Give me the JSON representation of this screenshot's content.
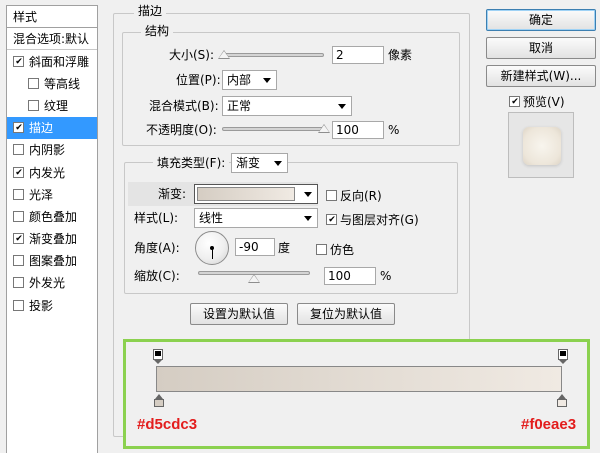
{
  "sidebar": {
    "header": "样式",
    "blend_options": "混合选项:默认",
    "items": [
      {
        "label": "斜面和浮雕",
        "checked": true,
        "sub": false,
        "active": false
      },
      {
        "label": "等高线",
        "checked": false,
        "sub": true,
        "active": false
      },
      {
        "label": "纹理",
        "checked": false,
        "sub": true,
        "active": false
      },
      {
        "label": "描边",
        "checked": true,
        "sub": false,
        "active": true
      },
      {
        "label": "内阴影",
        "checked": false,
        "sub": false,
        "active": false
      },
      {
        "label": "内发光",
        "checked": true,
        "sub": false,
        "active": false
      },
      {
        "label": "光泽",
        "checked": false,
        "sub": false,
        "active": false
      },
      {
        "label": "颜色叠加",
        "checked": false,
        "sub": false,
        "active": false
      },
      {
        "label": "渐变叠加",
        "checked": true,
        "sub": false,
        "active": false
      },
      {
        "label": "图案叠加",
        "checked": false,
        "sub": false,
        "active": false
      },
      {
        "label": "外发光",
        "checked": false,
        "sub": false,
        "active": false
      },
      {
        "label": "投影",
        "checked": false,
        "sub": false,
        "active": false
      }
    ]
  },
  "stroke": {
    "title": "描边",
    "structure": {
      "title": "结构",
      "size_label": "大小(S):",
      "size_value": "2",
      "size_unit": "像素",
      "size_fraction": 0.02,
      "position_label": "位置(P):",
      "position_value": "内部",
      "blend_label": "混合模式(B):",
      "blend_value": "正常",
      "opacity_label": "不透明度(O):",
      "opacity_value": "100",
      "opacity_unit": "%",
      "opacity_fraction": 1.0
    },
    "fill": {
      "type_label": "填充类型(F):",
      "type_value": "渐变",
      "gradient_label": "渐变:",
      "reverse_label": "反向(R)",
      "reverse_checked": false,
      "style_label": "样式(L):",
      "style_value": "线性",
      "align_label": "与图层对齐(G)",
      "align_checked": true,
      "angle_label": "角度(A):",
      "angle_value": "-90",
      "angle_unit": "度",
      "dither_label": "仿色",
      "dither_checked": false,
      "scale_label": "缩放(C):",
      "scale_value": "100",
      "scale_unit": "%",
      "scale_fraction": 0.5
    },
    "set_default_label": "设置为默认值",
    "reset_default_label": "复位为默认值"
  },
  "buttons": {
    "ok": "确定",
    "cancel": "取消",
    "new_style": "新建样式(W)...",
    "preview_label": "预览(V)",
    "preview_checked": true
  },
  "gradient_editor": {
    "left_color": "#d5cdc3",
    "right_color": "#f0eae3",
    "left_label": "#d5cdc3",
    "right_label": "#f0eae3"
  },
  "colors": {
    "selection": "#3399ff",
    "highlight_border": "#8bd14f",
    "annotation_text": "#e31d1d"
  }
}
